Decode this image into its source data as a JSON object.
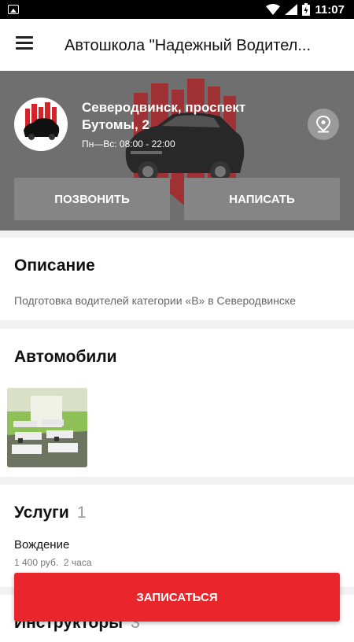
{
  "statusbar": {
    "time": "11:07"
  },
  "appbar": {
    "title": "Автошкола \"Надежный Водител..."
  },
  "hero": {
    "address": "Северодвинск, проспект Бутомы, 2",
    "hours": "Пн—Вс: 08:00 - 22:00",
    "call_label": "ПОЗВОНИТЬ",
    "write_label": "НАПИСАТЬ"
  },
  "description": {
    "title": "Описание",
    "text": "Подготовка водителей категории «В» в Северодвинске"
  },
  "cars": {
    "title": "Автомобили"
  },
  "services": {
    "title": "Услуги",
    "count": "1",
    "items": [
      {
        "name": "Вождение",
        "price": "1 400 руб.",
        "duration": "2 часа"
      }
    ]
  },
  "instructors": {
    "title": "Инструкторы",
    "count": "3"
  },
  "cta": {
    "label": "ЗАПИСАТЬСЯ"
  },
  "colors": {
    "accent": "#e8262b",
    "hero_bg": "#6f6f6f"
  }
}
